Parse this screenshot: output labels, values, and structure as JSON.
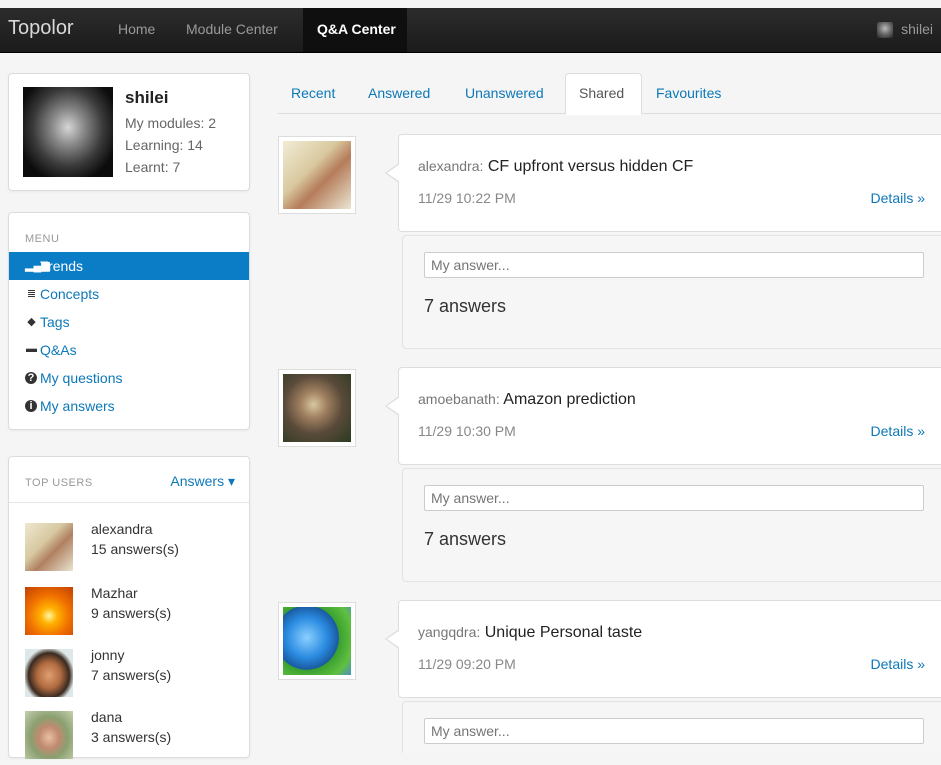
{
  "navbar": {
    "brand": "Topolor",
    "links": [
      "Home",
      "Module Center",
      "Q&A Center"
    ],
    "user": "shilei"
  },
  "profile": {
    "name": "shilei",
    "my_modules": "My modules: 2",
    "learning": "Learning: 14",
    "learnt": "Learnt: 7"
  },
  "menu": {
    "header": "MENU",
    "items": [
      {
        "label": "Trends",
        "icon": "chart-bars-icon",
        "glyph": "▂▄▆"
      },
      {
        "label": "Concepts",
        "icon": "list-icon",
        "glyph": "≣"
      },
      {
        "label": "Tags",
        "icon": "tag-icon",
        "glyph": "◆"
      },
      {
        "label": "Q&As",
        "icon": "comment-icon",
        "glyph": "▬"
      },
      {
        "label": "My questions",
        "icon": "question-circle-icon",
        "glyph": "?"
      },
      {
        "label": "My answers",
        "icon": "info-circle-icon",
        "glyph": "i"
      }
    ]
  },
  "top_users": {
    "header": "TOP USERS",
    "sort_label": "Answers ▾",
    "users": [
      {
        "name": "alexandra",
        "count": "15 answers(s)"
      },
      {
        "name": "Mazhar",
        "count": "9 answers(s)"
      },
      {
        "name": "jonny",
        "count": "7 answers(s)"
      },
      {
        "name": "dana",
        "count": "3 answers(s)"
      }
    ]
  },
  "tabs": [
    "Recent",
    "Answered",
    "Unanswered",
    "Shared",
    "Favourites"
  ],
  "questions": [
    {
      "author": "alexandra:",
      "title": "CF upfront versus hidden CF",
      "time": "11/29 10:22 PM",
      "details": "Details »",
      "placeholder": "My answer...",
      "answers": "7 answers"
    },
    {
      "author": "amoebanath:",
      "title": "Amazon prediction",
      "time": "11/29 10:30 PM",
      "details": "Details »",
      "placeholder": "My answer...",
      "answers": "7 answers"
    },
    {
      "author": "yangqdra:",
      "title": "Unique Personal taste",
      "time": "11/29 09:20 PM",
      "details": "Details »",
      "placeholder": "My answer..."
    }
  ]
}
